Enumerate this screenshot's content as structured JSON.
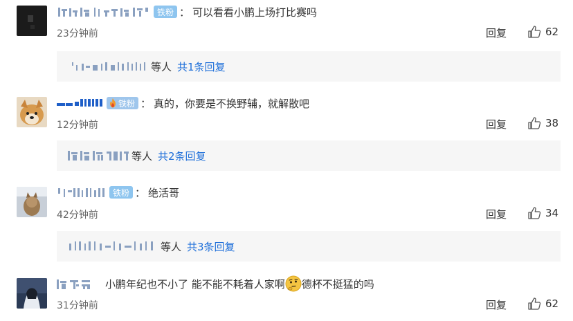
{
  "comments": [
    {
      "username": "你山误f 南孙司",
      "badge": "铁粉",
      "text": "可以看看小鹏上场打比赛吗",
      "time": "23分钟前",
      "reply_label": "回复",
      "likes": "62",
      "sub": {
        "names": "\"1 Ill ll ll",
        "suffix": "等人",
        "more": "共1条回复"
      }
    },
    {
      "username": "━━ ━ ▮▮▮▮",
      "badge": "铁粉",
      "text": "真的，你要是不换野辅，就解散吧",
      "time": "12分钟前",
      "reply_label": "回复",
      "likes": "38",
      "sub": {
        "names": "你忙世2017",
        "suffix": "等人",
        "more": "共2条回复"
      }
    },
    {
      "username": "ˊ i ˡ ll ll ll",
      "badge": "铁粉",
      "text": "绝活哥",
      "time": "42分钟前",
      "reply_label": "回复",
      "likes": "34",
      "sub": {
        "names": "l ll ll ll ll ll",
        "suffix": "等人",
        "more": "共3条回复"
      }
    },
    {
      "username": "悦下云",
      "text_before": "小鹏年纪也不小了 能不能不耗着人家啊",
      "text_after": "德杯不挺猛的吗",
      "time": "31分钟前",
      "reply_label": "回复",
      "likes": "62"
    }
  ],
  "colors": {
    "badge": "#8ec5ef",
    "link": "#1e6fd9",
    "sub_bg": "#f6f6f6",
    "time": "#666666"
  },
  "icons": [
    "thumb-up-icon",
    "fire-icon",
    "thinking-emoji"
  ]
}
